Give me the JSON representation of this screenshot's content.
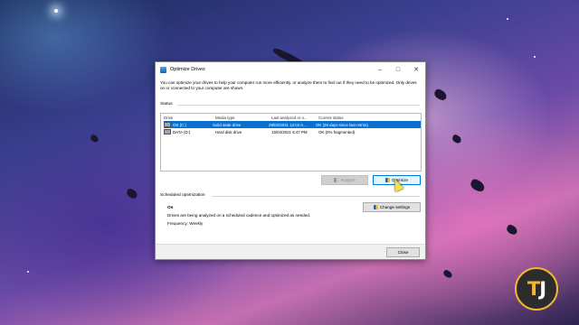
{
  "window": {
    "title": "Optimize Drives",
    "description": "You can optimize your drives to help your computer run more efficiently, or analyze them to find out if they need to be optimized. Only drives on or connected to your computer are shown."
  },
  "status": {
    "label": "Status",
    "columns": [
      "Drive",
      "Media type",
      "Last analyzed or o...",
      "Current status"
    ],
    "rows": [
      {
        "drive": "OS (C:)",
        "media": "Solid state drive",
        "last": "29/03/2021 12:02 A...",
        "status": "OK (25 days since last retrim)"
      },
      {
        "drive": "DATA (D:)",
        "media": "Hard disk drive",
        "last": "15/04/2021 8:47 PM",
        "status": "OK (0% fragmented)"
      }
    ],
    "selected_row": 0
  },
  "buttons": {
    "analyze": "Analyze",
    "optimize": "Optimize",
    "change_settings": "Change settings",
    "close": "Close"
  },
  "scheduled": {
    "label": "Scheduled optimization",
    "state": "On",
    "text": "Drives are being analyzed on a scheduled cadence and optimized as needed.",
    "frequency": "Frequency: Weekly"
  },
  "logo": {
    "t": "T",
    "j": "J"
  },
  "colors": {
    "accent": "#0a70d0",
    "logo": "#f2b632"
  }
}
